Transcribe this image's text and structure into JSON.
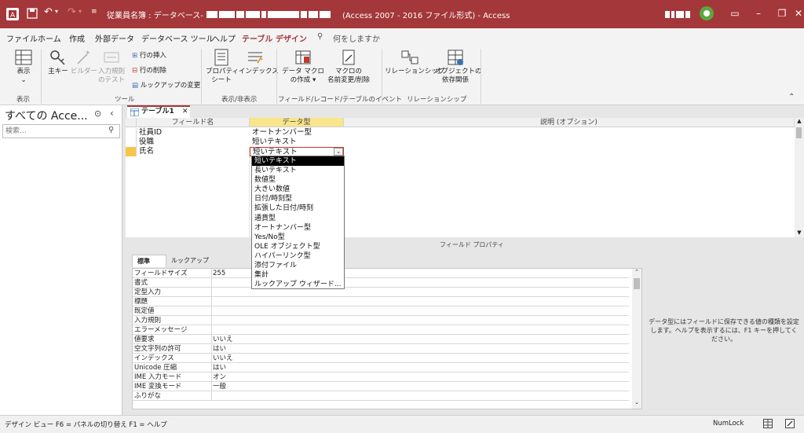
{
  "titlebar": {
    "title_prefix": "従業員名簿 : データベース-",
    "title_suffix": "(Access 2007 - 2016 ファイル形式)  -  Access"
  },
  "menu": [
    "ファイル",
    "ホーム",
    "作成",
    "外部データ",
    "データベース ツール",
    "ヘルプ",
    "テーブル デザイン"
  ],
  "tell_me": "何をしますか",
  "ribbon": {
    "view": "表示",
    "primary_key": "主キー",
    "builder": "ビルダー",
    "test_rules_1": "入力規則",
    "test_rules_2": "のテスト",
    "insert_rows": "行の挿入",
    "delete_rows": "行の削除",
    "modify_lookups": "ルックアップの変更",
    "property_sheet_1": "プロパティ",
    "property_sheet_2": "シート",
    "indexes": "インデックス",
    "create_macros_1": "データ マクロ",
    "create_macros_2": "の作成 ▾",
    "rename_macro_1": "マクロの",
    "rename_macro_2": "名前変更/削除",
    "relationships": "リレーションシップ",
    "dependencies_1": "オブジェクトの",
    "dependencies_2": "依存関係",
    "groups": [
      "表示",
      "ツール",
      "表示/非表示",
      "フィールド/レコード/テーブルのイベント",
      "リレーションシップ"
    ]
  },
  "nav": {
    "title": "すべての Acce...",
    "search_placeholder": "検索..."
  },
  "tab": {
    "label": "テーブル1"
  },
  "grid": {
    "headers": [
      "フィールド名",
      "データ型",
      "説明 (オプション)"
    ],
    "rows": [
      {
        "name": "社員ID",
        "type": "オートナンバー型"
      },
      {
        "name": "役職",
        "type": "短いテキスト"
      },
      {
        "name": "氏名",
        "type": "短いテキスト"
      }
    ]
  },
  "dropdown": {
    "options": [
      "短いテキスト",
      "長いテキスト",
      "数値型",
      "大きい数値",
      "日付/時刻型",
      "拡張した日付/時刻",
      "通貨型",
      "オートナンバー型",
      "Yes/No型",
      "OLE オブジェクト型",
      "ハイパーリンク型",
      "添付ファイル",
      "集計",
      "ルックアップ ウィザード..."
    ],
    "selected_index": 0
  },
  "properties": {
    "label": "フィールド プロパティ",
    "tabs": [
      "標準",
      "ルックアップ"
    ],
    "rows": [
      {
        "name": "フィールドサイズ",
        "value": "255"
      },
      {
        "name": "書式",
        "value": ""
      },
      {
        "name": "定型入力",
        "value": ""
      },
      {
        "name": "標題",
        "value": ""
      },
      {
        "name": "既定値",
        "value": ""
      },
      {
        "name": "入力規則",
        "value": ""
      },
      {
        "name": "エラーメッセージ",
        "value": ""
      },
      {
        "name": "値要求",
        "value": "いいえ"
      },
      {
        "name": "空文字列の許可",
        "value": "はい"
      },
      {
        "name": "インデックス",
        "value": "いいえ"
      },
      {
        "name": "Unicode 圧縮",
        "value": "はい"
      },
      {
        "name": "IME 入力モード",
        "value": "オン"
      },
      {
        "name": "IME 変換モード",
        "value": "一般"
      },
      {
        "name": "ふりがな",
        "value": ""
      }
    ],
    "help": "データ型にはフィールドに保存できる値の種類を設定します。ヘルプを表示するには、F1 キーを押してください。"
  },
  "status": {
    "left": "デザイン ビュー   F6 = パネルの切り替え   F1 = ヘルプ",
    "right": "NumLock"
  },
  "colors": {
    "accent": "#a4373a"
  }
}
